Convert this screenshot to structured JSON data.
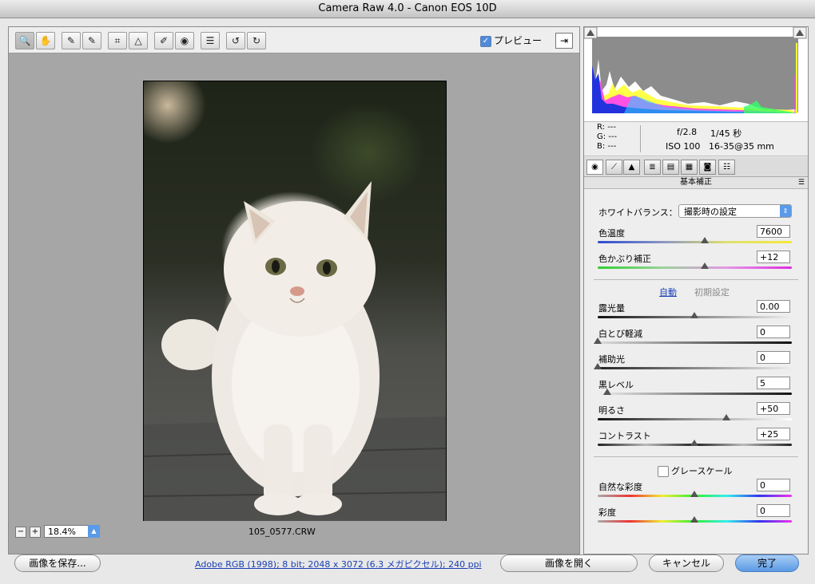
{
  "window": {
    "title": "Camera Raw 4.0  -  Canon EOS 10D"
  },
  "toolbar": {
    "tools": [
      {
        "name": "zoom-tool",
        "icon": "🔍"
      },
      {
        "name": "hand-tool",
        "icon": "✋"
      },
      {
        "name": "white-balance-tool",
        "icon": "✎"
      },
      {
        "name": "color-sampler-tool",
        "icon": "✎"
      },
      {
        "name": "crop-tool",
        "icon": "⌗"
      },
      {
        "name": "straighten-tool",
        "icon": "△"
      },
      {
        "name": "retouch-tool",
        "icon": "✐"
      },
      {
        "name": "red-eye-tool",
        "icon": "◉"
      },
      {
        "name": "preferences-tool",
        "icon": "☰"
      },
      {
        "name": "rotate-ccw-tool",
        "icon": "↺"
      },
      {
        "name": "rotate-cw-tool",
        "icon": "↻"
      }
    ],
    "preview_label": "プレビュー",
    "preview_checked": true
  },
  "status": {
    "zoom_out": "−",
    "zoom_in": "+",
    "zoom_value": "18.4%",
    "filename": "105_0577.CRW"
  },
  "info": {
    "r": "R:   ---",
    "g": "G:   ---",
    "b": "B:   ---",
    "aperture": "f/2.8",
    "shutter": "1/45 秒",
    "iso": "ISO 100",
    "lens": "16-35@35 mm"
  },
  "panel": {
    "section_title": "基本補正",
    "white_balance_label": "ホワイトバランス：",
    "white_balance_value": "撮影時の設定",
    "sliders_wb": [
      {
        "label": "色温度",
        "value": "7600"
      },
      {
        "label": "色かぶり補正",
        "value": "+12"
      }
    ],
    "auto_label": "自動",
    "default_label": "初期設定",
    "sliders_tone": [
      {
        "label": "露光量",
        "value": "0.00"
      },
      {
        "label": "白とび軽減",
        "value": "0"
      },
      {
        "label": "補助光",
        "value": "0"
      },
      {
        "label": "黒レベル",
        "value": "5"
      },
      {
        "label": "明るさ",
        "value": "+50"
      },
      {
        "label": "コントラスト",
        "value": "+25"
      }
    ],
    "grayscale_label": "グレースケール",
    "grayscale_checked": false,
    "sliders_color": [
      {
        "label": "自然な彩度",
        "value": "0"
      },
      {
        "label": "彩度",
        "value": "0"
      }
    ]
  },
  "footer": {
    "save_label": "画像を保存...",
    "workflow_link": "Adobe RGB (1998); 8 bit; 2048 x 3072 (6.3 メガピクセル); 240 ppi",
    "open_label": "画像を開く",
    "cancel_label": "キャンセル",
    "done_label": "完了"
  },
  "colors": {
    "accent": "#5a9ae4",
    "link": "#1a3fb4"
  }
}
